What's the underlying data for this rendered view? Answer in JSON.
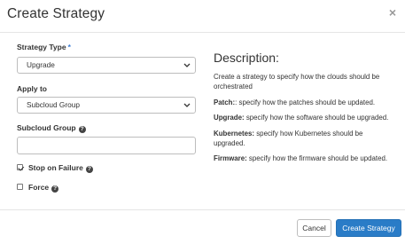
{
  "modal": {
    "title": "Create Strategy",
    "close_symbol": "×"
  },
  "form": {
    "strategy_type": {
      "label": "Strategy Type",
      "required_marker": "*",
      "value": "Upgrade"
    },
    "apply_to": {
      "label": "Apply to",
      "value": "Subcloud Group"
    },
    "subcloud_group": {
      "label": "Subcloud Group",
      "value": "",
      "help_icon": "question-circle-icon"
    },
    "stop_on_failure": {
      "label": "Stop on Failure",
      "checked": true,
      "help_icon": "question-circle-icon"
    },
    "force": {
      "label": "Force",
      "checked": false,
      "help_icon": "question-circle-icon"
    }
  },
  "description": {
    "title": "Description:",
    "intro": "Create a strategy to specify how the clouds should be orchestrated",
    "items": [
      {
        "term": "Patch:",
        "text": ": specify how the patches should be updated."
      },
      {
        "term": "Upgrade:",
        "text": " specify how the software should be upgraded."
      },
      {
        "term": "Kubernetes:",
        "text": " specify how Kubernetes should be upgraded."
      },
      {
        "term": "Firmware:",
        "text": " specify how the firmware should be updated."
      }
    ]
  },
  "footer": {
    "cancel_label": "Cancel",
    "submit_label": "Create Strategy"
  },
  "colors": {
    "primary": "#2a7cc7",
    "required_marker": "#3a7bd5"
  }
}
